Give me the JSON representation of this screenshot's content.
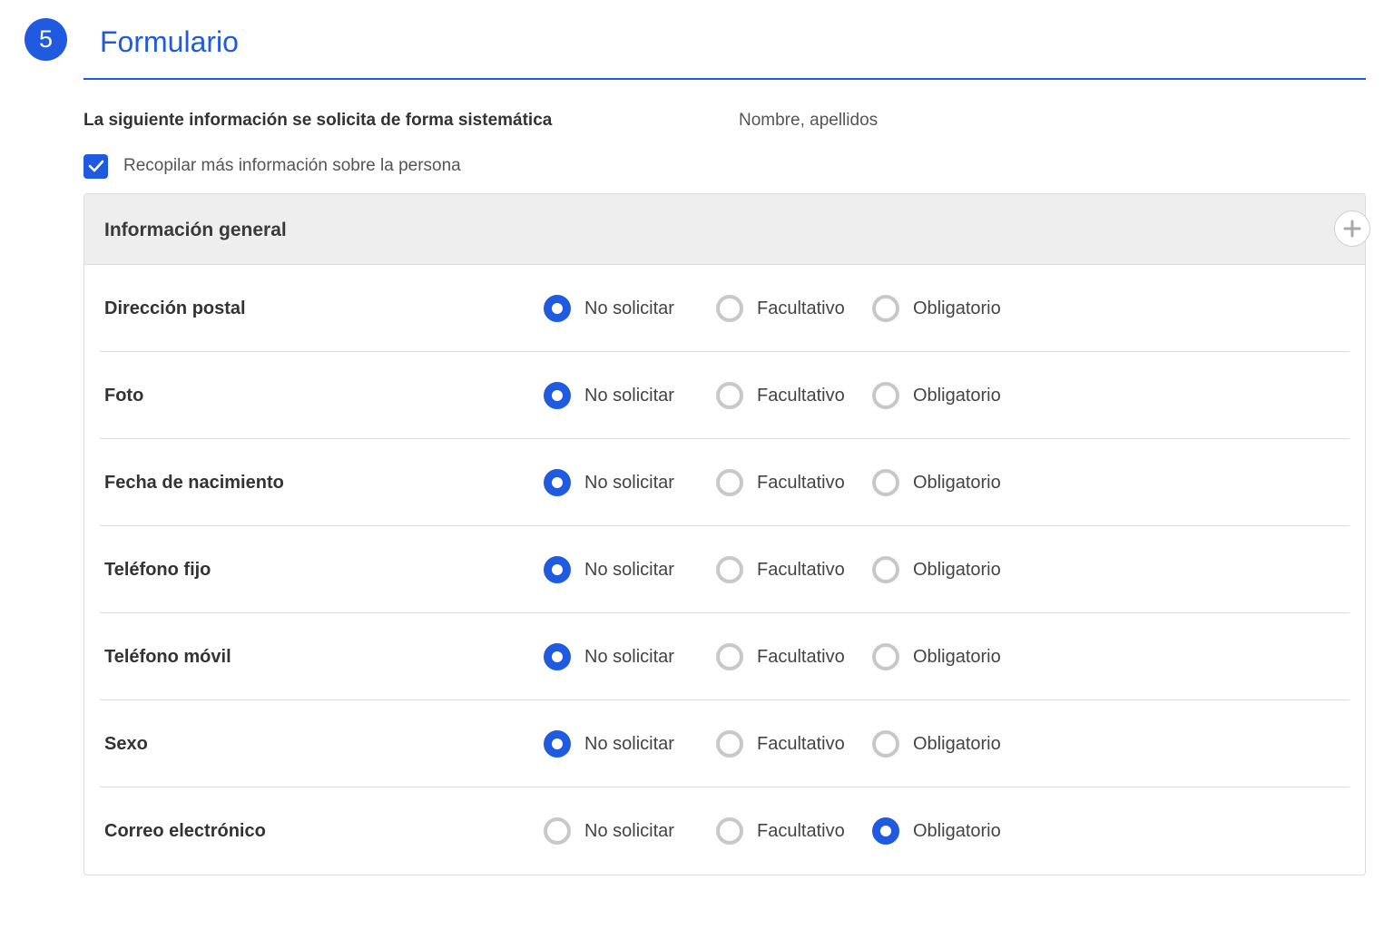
{
  "section": {
    "step_number": "5",
    "title": "Formulario"
  },
  "systematic": {
    "label": "La siguiente información se solicita de forma sistemática",
    "value": "Nombre, apellidos"
  },
  "more_info": {
    "checked": true,
    "label": "Recopilar más información sobre la persona"
  },
  "panel": {
    "title": "Información general",
    "add_icon": "plus-icon"
  },
  "options": [
    "No solicitar",
    "Facultativo",
    "Obligatorio"
  ],
  "rows": [
    {
      "label": "Dirección postal",
      "selected": "No solicitar"
    },
    {
      "label": "Foto",
      "selected": "No solicitar"
    },
    {
      "label": "Fecha de nacimiento",
      "selected": "No solicitar"
    },
    {
      "label": "Teléfono fijo",
      "selected": "No solicitar"
    },
    {
      "label": "Teléfono móvil",
      "selected": "No solicitar"
    },
    {
      "label": "Sexo",
      "selected": "No solicitar"
    },
    {
      "label": "Correo electrónico",
      "selected": "Obligatorio"
    }
  ],
  "colors": {
    "accent": "#1f5ae0",
    "radio_unchecked": "#c8c8c8",
    "panel_header": "#eeeeee"
  }
}
